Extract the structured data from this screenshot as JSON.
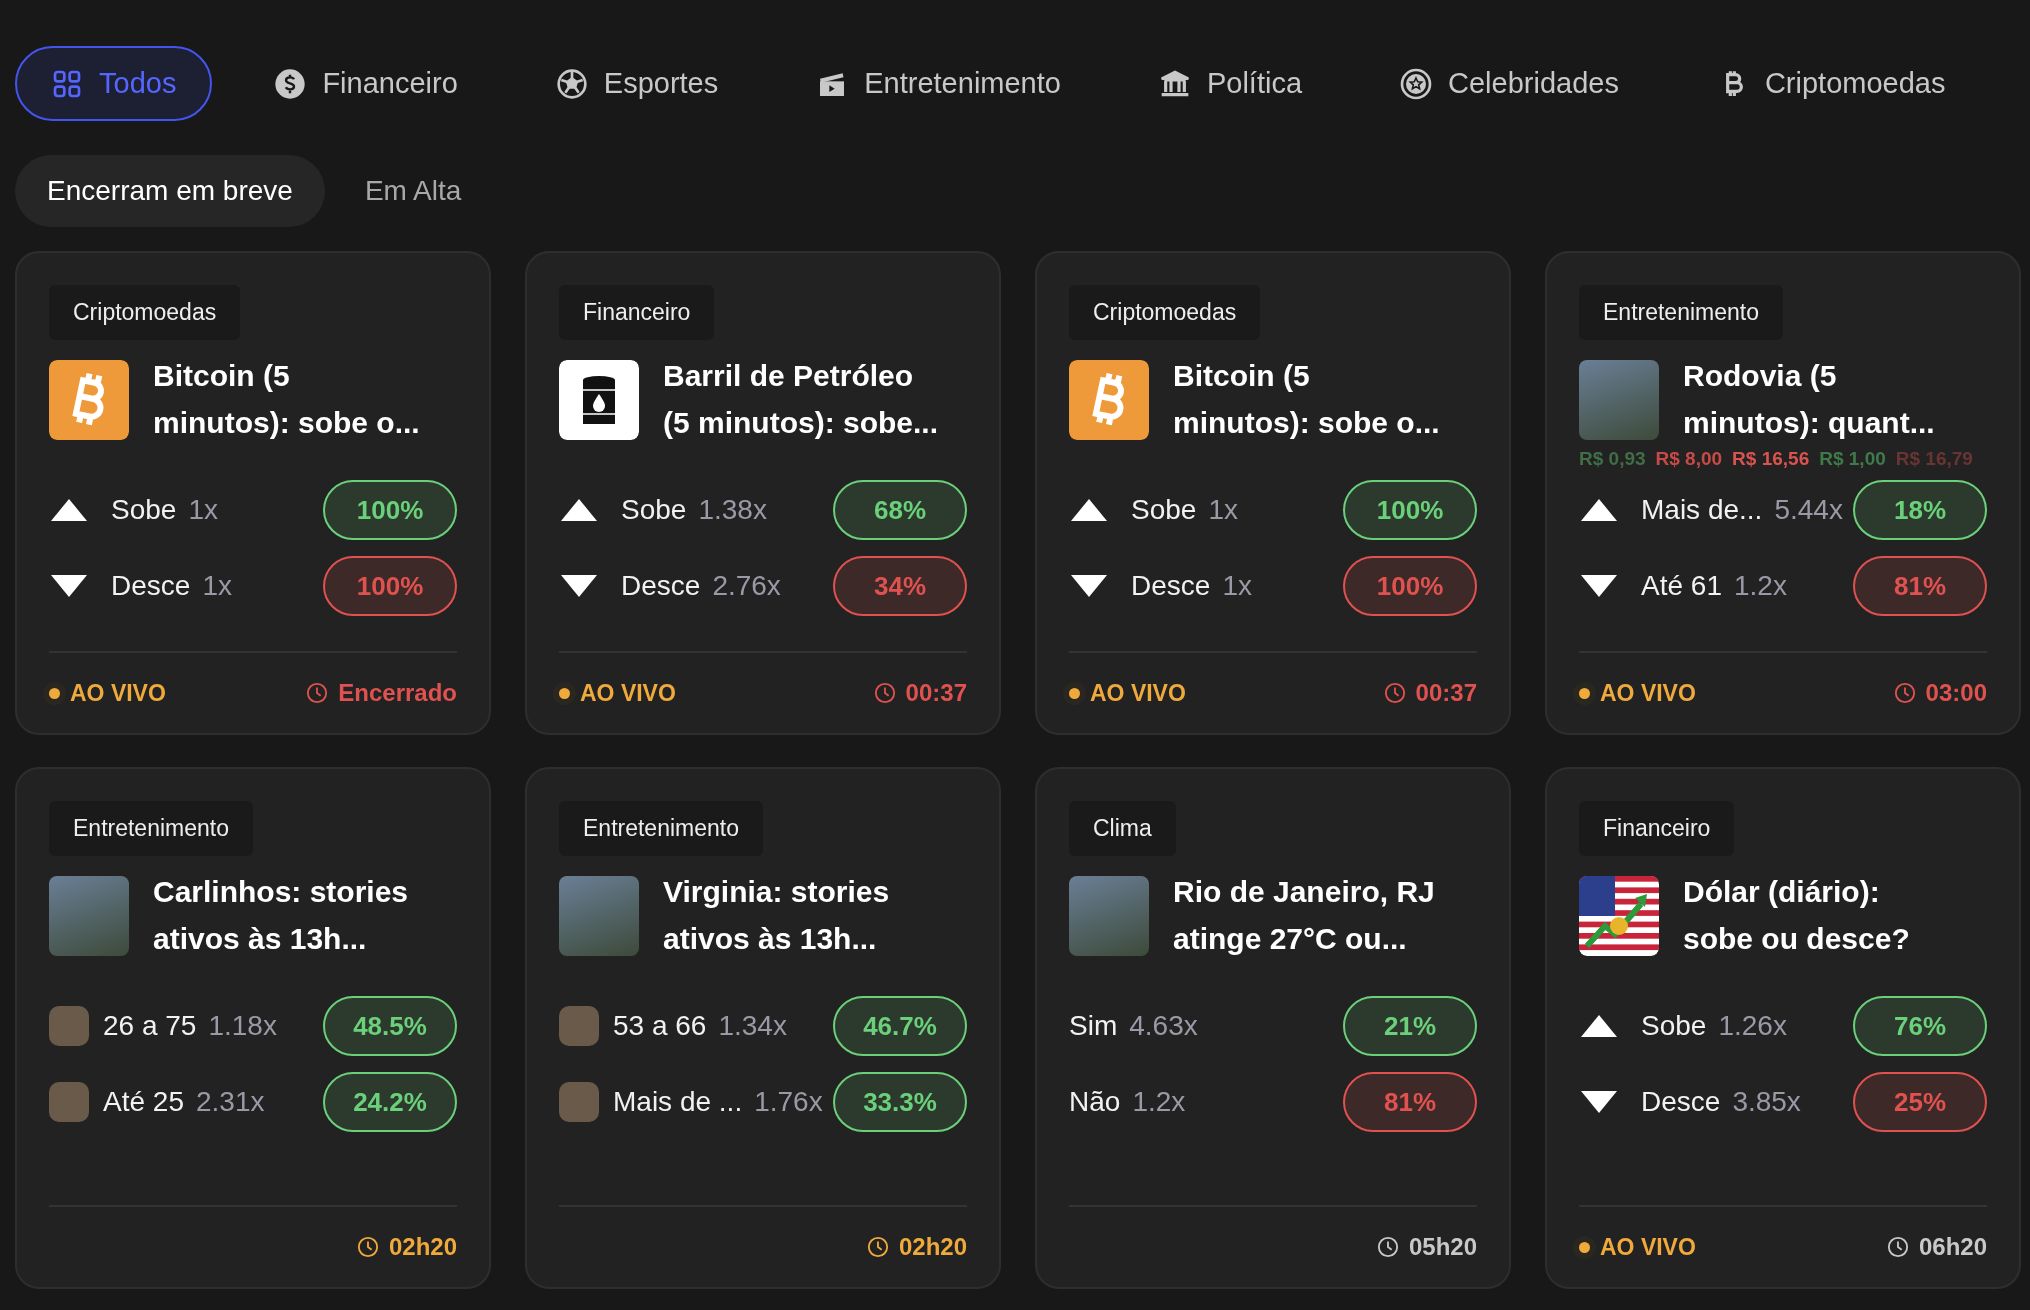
{
  "tabs": [
    {
      "label": "Todos",
      "kind": "grid",
      "selected": true
    },
    {
      "label": "Financeiro",
      "kind": "dollar",
      "selected": false
    },
    {
      "label": "Esportes",
      "kind": "ball",
      "selected": false
    },
    {
      "label": "Entretenimento",
      "kind": "clapper",
      "selected": false
    },
    {
      "label": "Política",
      "kind": "bank",
      "selected": false
    },
    {
      "label": "Celebridades",
      "kind": "star",
      "selected": false
    },
    {
      "label": "Criptomoedas",
      "kind": "bitcoin",
      "selected": false
    }
  ],
  "filters": [
    {
      "label": "Encerram em breve",
      "selected": true
    },
    {
      "label": "Em Alta",
      "selected": false
    }
  ],
  "cards": [
    {
      "category": "Criptomoedas",
      "kind": "bitcoin",
      "title": "Bitcoin (5\nminutos): sobe o...",
      "options": [
        {
          "kind": "up",
          "label": "Sobe",
          "multiplier": "1x",
          "percent": "100%",
          "color": "#6bd07a"
        },
        {
          "kind": "down",
          "label": "Desce",
          "multiplier": "1x",
          "percent": "100%",
          "color": "#e0524f"
        }
      ],
      "live": true,
      "live_label": "AO VIVO",
      "time": "Encerrado",
      "color": "#e0524f"
    },
    {
      "category": "Financeiro",
      "kind": "barrel",
      "title": "Barril de Petróleo\n(5 minutos): sobe...",
      "options": [
        {
          "kind": "up",
          "label": "Sobe",
          "multiplier": "1.38x",
          "percent": "68%",
          "color": "#6bd07a"
        },
        {
          "kind": "down",
          "label": "Desce",
          "multiplier": "2.76x",
          "percent": "34%",
          "color": "#e0524f"
        }
      ],
      "live": true,
      "live_label": "AO VIVO",
      "time": "00:37",
      "color": "#e0524f"
    },
    {
      "category": "Criptomoedas",
      "kind": "bitcoin",
      "title": "Bitcoin (5\nminutos): sobe o...",
      "options": [
        {
          "kind": "up",
          "label": "Sobe",
          "multiplier": "1x",
          "percent": "100%",
          "color": "#6bd07a"
        },
        {
          "kind": "down",
          "label": "Desce",
          "multiplier": "1x",
          "percent": "100%",
          "color": "#e0524f"
        }
      ],
      "live": true,
      "live_label": "AO VIVO",
      "time": "00:37",
      "color": "#e0524f"
    },
    {
      "category": "Entretenimento",
      "kind": "photo",
      "title": "Rodovia (5\nminutos): quant...",
      "options": [
        {
          "kind": "up",
          "label": "Mais de...",
          "multiplier": "5.44x",
          "percent": "18%",
          "color": "#6bd07a"
        },
        {
          "kind": "down",
          "label": "Até 61",
          "multiplier": "1.2x",
          "percent": "81%",
          "color": "#e0524f"
        }
      ],
      "floating_prices": [
        {
          "text": "R$ 0,93",
          "color": "#3f6e47"
        },
        {
          "text": "R$ 8,00",
          "color": "#c84a46"
        },
        {
          "text": "R$ 16,56",
          "color": "#d9534f"
        },
        {
          "text": "R$ 1,00",
          "color": "#3f7a4a"
        },
        {
          "text": "R$ 16,79",
          "color": "#6a3434"
        }
      ],
      "live": true,
      "live_label": "AO VIVO",
      "time": "03:00",
      "color": "#e0524f"
    },
    {
      "category": "Entretenimento",
      "kind": "photo",
      "title": "Carlinhos: stories\nativos às 13h...",
      "options": [
        {
          "kind": "avatar",
          "label": "26 a 75",
          "multiplier": "1.18x",
          "percent": "48.5%",
          "color": "#6bd07a"
        },
        {
          "kind": "avatar",
          "label": "Até 25",
          "multiplier": "2.31x",
          "percent": "24.2%",
          "color": "#6bd07a"
        }
      ],
      "live": false,
      "time": "02h20",
      "color": "#f0a93b"
    },
    {
      "category": "Entretenimento",
      "kind": "photo",
      "title": "Virginia: stories\nativos às 13h...",
      "options": [
        {
          "kind": "avatar",
          "label": "53 a 66",
          "multiplier": "1.34x",
          "percent": "46.7%",
          "color": "#6bd07a"
        },
        {
          "kind": "avatar",
          "label": "Mais de ...",
          "multiplier": "1.76x",
          "percent": "33.3%",
          "color": "#6bd07a"
        }
      ],
      "live": false,
      "time": "02h20",
      "color": "#f0a93b"
    },
    {
      "category": "Clima",
      "kind": "photo",
      "title": "Rio de Janeiro, RJ\natinge 27°C ou...",
      "options": [
        {
          "kind": "none",
          "label": "Sim",
          "multiplier": "4.63x",
          "percent": "21%",
          "color": "#6bd07a"
        },
        {
          "kind": "none",
          "label": "Não",
          "multiplier": "1.2x",
          "percent": "81%",
          "color": "#e0524f"
        }
      ],
      "live": false,
      "time": "05h20",
      "color": "#c8c8c8"
    },
    {
      "category": "Financeiro",
      "kind": "flag",
      "title": "Dólar (diário):\nsobe ou desce?",
      "options": [
        {
          "kind": "up",
          "label": "Sobe",
          "multiplier": "1.26x",
          "percent": "76%",
          "color": "#6bd07a"
        },
        {
          "kind": "down",
          "label": "Desce",
          "multiplier": "3.85x",
          "percent": "25%",
          "color": "#e0524f"
        }
      ],
      "live": true,
      "live_label": "AO VIVO",
      "time": "06h20",
      "color": "#c8c8c8"
    }
  ]
}
